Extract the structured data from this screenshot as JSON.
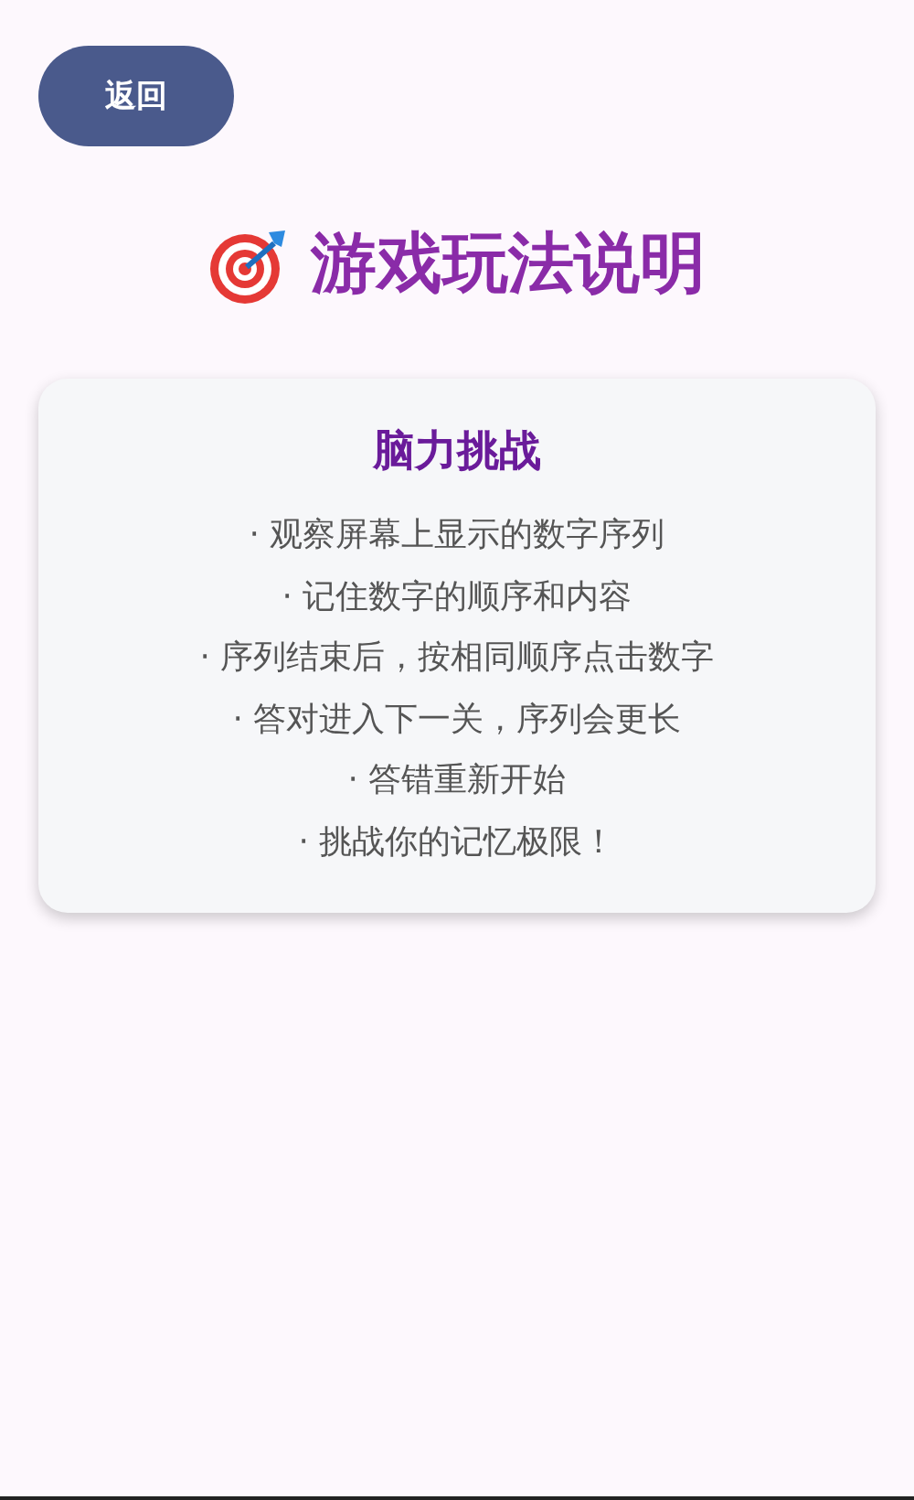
{
  "back_button": {
    "label": "返回"
  },
  "title": "游戏玩法说明",
  "card": {
    "heading": "脑力挑战",
    "rules": [
      "· 观察屏幕上显示的数字序列",
      "· 记住数字的顺序和内容",
      "· 序列结束后，按相同顺序点击数字",
      "· 答对进入下一关，序列会更长",
      "· 答错重新开始",
      "· 挑战你的记忆极限！"
    ]
  }
}
